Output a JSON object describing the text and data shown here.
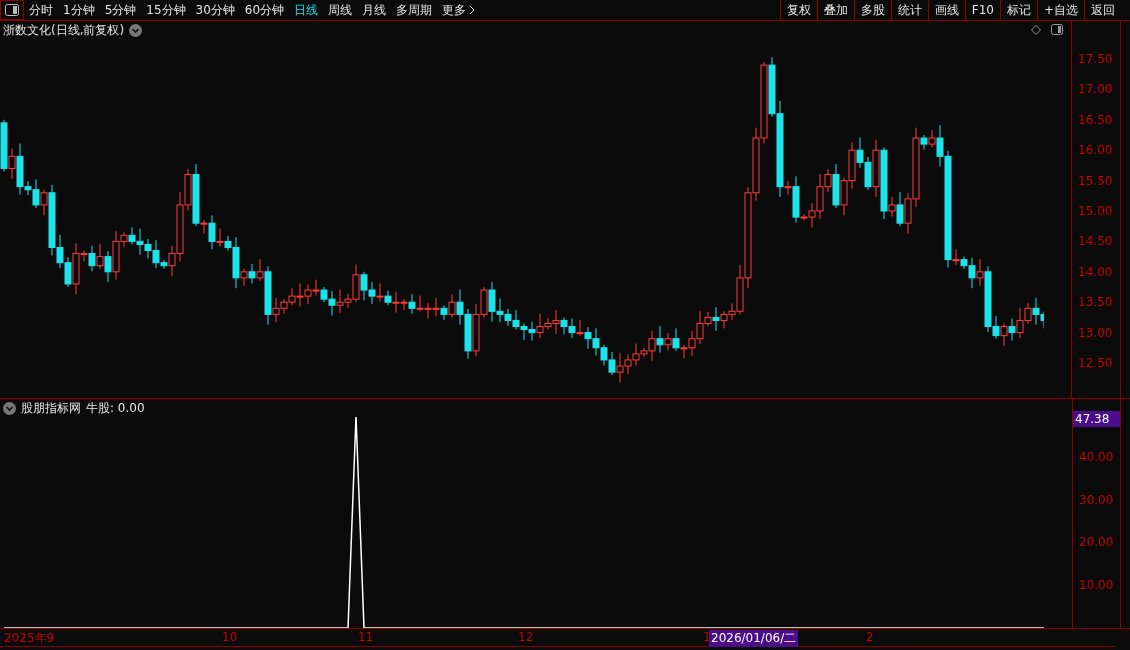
{
  "toolbar": {
    "periods": [
      {
        "label": "分时",
        "selected": false
      },
      {
        "label": "1分钟",
        "selected": false
      },
      {
        "label": "5分钟",
        "selected": false
      },
      {
        "label": "15分钟",
        "selected": false
      },
      {
        "label": "30分钟",
        "selected": false
      },
      {
        "label": "60分钟",
        "selected": false
      },
      {
        "label": "日线",
        "selected": true
      },
      {
        "label": "周线",
        "selected": false
      },
      {
        "label": "月线",
        "selected": false
      },
      {
        "label": "多周期",
        "selected": false
      }
    ],
    "more": "更多",
    "actions": [
      "复权",
      "叠加",
      "多股",
      "统计",
      "画线",
      "F10",
      "标记",
      "+自选",
      "返回"
    ]
  },
  "price_panel": {
    "title": "浙数文化(日线,前复权)",
    "axis": [
      "17.50",
      "17.00",
      "16.50",
      "16.00",
      "15.50",
      "15.00",
      "14.50",
      "14.00",
      "13.50",
      "13.00",
      "12.50"
    ]
  },
  "indicator_panel": {
    "name": "股朋指标网",
    "reading": "牛股: 0.00",
    "current_value": "47.38",
    "chart_data": {
      "type": "line",
      "ylim": [
        0,
        54
      ],
      "yticks": [
        {
          "value": 40,
          "label": "40.00"
        },
        {
          "value": 30,
          "label": "30.00"
        },
        {
          "value": 20,
          "label": "20.00"
        },
        {
          "value": 10,
          "label": "10.00"
        }
      ],
      "values": [
        0,
        0,
        0,
        0,
        0,
        0,
        0,
        0,
        0,
        0,
        0,
        0,
        0,
        0,
        0,
        0,
        0,
        0,
        0,
        0,
        0,
        0,
        0,
        0,
        0,
        0,
        0,
        0,
        0,
        0,
        0,
        0,
        0,
        0,
        0,
        0,
        0,
        0,
        0,
        0,
        0,
        0,
        0,
        0,
        50,
        0,
        0,
        0,
        0,
        0,
        0,
        0,
        0,
        0,
        0,
        0,
        0,
        0,
        0,
        0,
        0,
        0,
        0,
        0,
        0,
        0,
        0,
        0,
        0,
        0,
        0,
        0,
        0,
        0,
        0,
        0,
        0,
        0,
        0,
        0,
        0,
        0,
        0,
        0,
        0,
        0,
        0,
        0,
        0,
        0,
        0,
        0,
        0,
        0,
        0,
        0,
        0,
        0,
        0,
        0,
        0,
        0,
        0,
        0,
        0,
        0,
        0,
        0,
        0,
        0,
        0,
        0,
        0,
        0,
        0,
        0,
        0,
        0,
        0,
        0,
        0,
        0,
        0,
        0,
        0,
        0,
        0,
        0,
        0,
        0,
        0
      ]
    }
  },
  "time_axis": [
    {
      "label": "2025年9",
      "kind": "tick"
    },
    {
      "label": "10",
      "kind": "tick"
    },
    {
      "label": "11",
      "kind": "tick"
    },
    {
      "label": "12",
      "kind": "tick"
    },
    {
      "label": "1",
      "kind": "tick"
    },
    {
      "label": "2026/01/06/二",
      "kind": "cursor"
    },
    {
      "label": "2",
      "kind": "tick"
    }
  ]
}
